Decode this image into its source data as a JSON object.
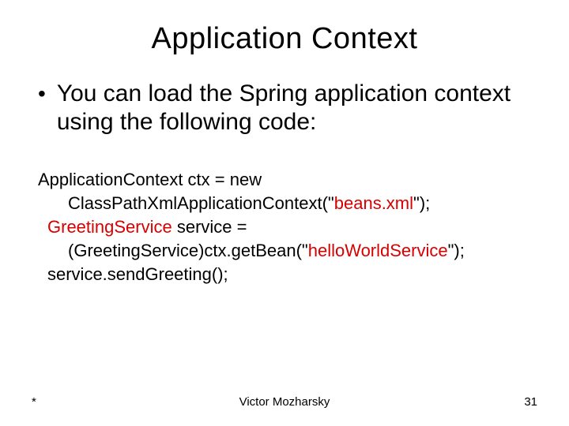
{
  "title": "Application Context",
  "bullet": "You can load the Spring application context using the following code:",
  "code": {
    "l1": "ApplicationContext ctx = new",
    "l2a": "ClassPathXmlApplicationContext(\"",
    "l2b": "beans.xml",
    "l2c": "\");",
    "l3a": "GreetingService",
    "l3b": " service = ",
    "l4a": "(GreetingService)ctx.getBean(\"",
    "l4b": "helloWorldService",
    "l4c": "\");",
    "l5": "service.sendGreeting();"
  },
  "footer": {
    "left": "*",
    "center": "Victor Mozharsky",
    "right": "31"
  }
}
